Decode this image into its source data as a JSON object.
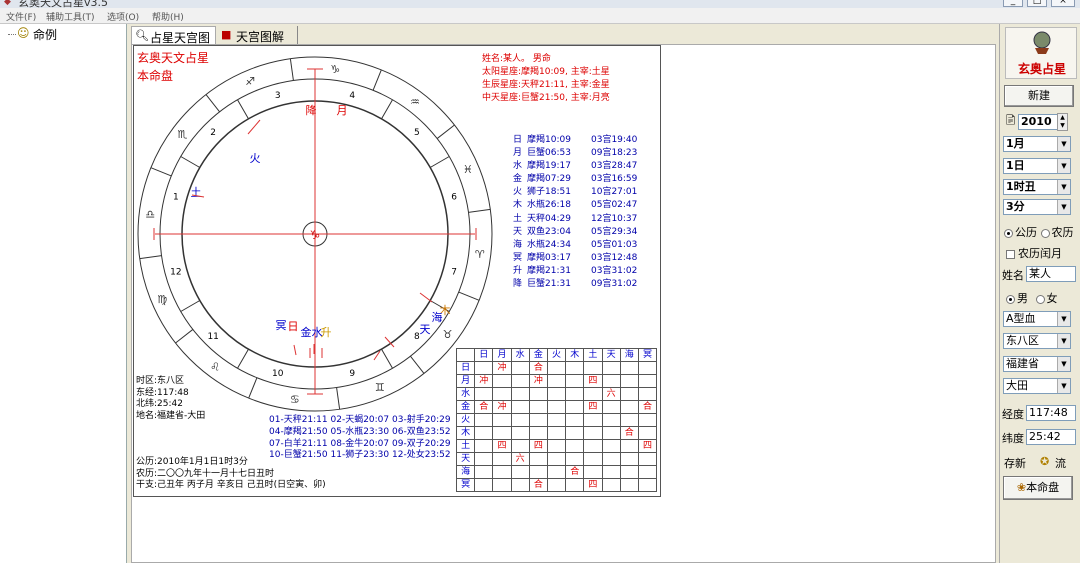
{
  "window": {
    "title": "玄奥天文占星v3.5"
  },
  "menu": [
    "文件(F)",
    "辅助工具(T)",
    "选项(O)",
    "帮助(H)"
  ],
  "tree": {
    "root": "命例"
  },
  "tabs": [
    "占星天宫图",
    "天宫图解说"
  ],
  "chart": {
    "brand": "玄奥天文占星",
    "natal_label": "本命盘",
    "person": [
      "姓名:某人。 男命",
      "太阳星座:摩羯10:09, 主宰:土星",
      "生辰星座:天秤21:11, 主宰:金星",
      "中天星座:巨蟹21:50, 主宰:月亮"
    ],
    "planets": [
      {
        "name": "日",
        "sign": "摩羯10:09",
        "house": "03宫19:40"
      },
      {
        "name": "月",
        "sign": "巨蟹06:53",
        "house": "09宫18:23"
      },
      {
        "name": "水",
        "sign": "摩羯19:17",
        "house": "03宫28:47"
      },
      {
        "name": "金",
        "sign": "摩羯07:29",
        "house": "03宫16:59"
      },
      {
        "name": "火",
        "sign": "狮子18:51",
        "house": "10宫27:01"
      },
      {
        "name": "木",
        "sign": "水瓶26:18",
        "house": "05宫02:47"
      },
      {
        "name": "土",
        "sign": "天秤04:29",
        "house": "12宫10:37"
      },
      {
        "name": "天",
        "sign": "双鱼23:04",
        "house": "05宫29:34"
      },
      {
        "name": "海",
        "sign": "水瓶24:34",
        "house": "05宫01:03"
      },
      {
        "name": "冥",
        "sign": "摩羯03:17",
        "house": "03宫12:48"
      },
      {
        "name": "升",
        "sign": "摩羯21:31",
        "house": "03宫31:02"
      },
      {
        "name": "降",
        "sign": "巨蟹21:31",
        "house": "09宫31:02"
      }
    ],
    "location": [
      "时区:东八区",
      "东经:117:48",
      "北纬:25:42",
      "地名:福建省-大田"
    ],
    "houses": [
      "01-天秤21:11  02-天蝎20:07  03-射手20:29",
      "04-摩羯21:50  05-水瓶23:30  06-双鱼23:52",
      "07-白羊21:11  08-金牛20:07  09-双子20:29",
      "10-巨蟹21:50  11-狮子23:30  12-处女23:52"
    ],
    "dates": [
      "公历:2010年1月1日1时3分",
      "农历:二〇〇九年十一月十七日丑时",
      "干支:己丑年  丙子月  辛亥日  己丑时(日空寅、卯)"
    ],
    "aspect_headers": [
      "日",
      "月",
      "水",
      "金",
      "火",
      "木",
      "土",
      "天",
      "海",
      "冥"
    ],
    "aspect_rows": [
      {
        "label": "日",
        "cells": [
          "",
          "冲",
          "",
          "合",
          "",
          "",
          "",
          "",
          "",
          ""
        ]
      },
      {
        "label": "月",
        "cells": [
          "冲",
          "",
          "",
          "冲",
          "",
          "",
          "四",
          "",
          "",
          ""
        ]
      },
      {
        "label": "水",
        "cells": [
          "",
          "",
          "",
          "",
          "",
          "",
          "",
          "六",
          "",
          ""
        ]
      },
      {
        "label": "金",
        "cells": [
          "合",
          "冲",
          "",
          "",
          "",
          "",
          "四",
          "",
          "",
          "合"
        ]
      },
      {
        "label": "火",
        "cells": [
          "",
          "",
          "",
          "",
          "",
          "",
          "",
          "",
          "",
          ""
        ]
      },
      {
        "label": "木",
        "cells": [
          "",
          "",
          "",
          "",
          "",
          "",
          "",
          "",
          "合",
          ""
        ]
      },
      {
        "label": "土",
        "cells": [
          "",
          "四",
          "",
          "四",
          "",
          "",
          "",
          "",
          "",
          "四"
        ]
      },
      {
        "label": "天",
        "cells": [
          "",
          "",
          "六",
          "",
          "",
          "",
          "",
          "",
          "",
          ""
        ]
      },
      {
        "label": "海",
        "cells": [
          "",
          "",
          "",
          "",
          "",
          "合",
          "",
          "",
          "",
          ""
        ]
      },
      {
        "label": "冥",
        "cells": [
          "",
          "",
          "",
          "合",
          "",
          "",
          "四",
          "",
          "",
          ""
        ]
      }
    ],
    "wheel": {
      "house_numbers": [
        "1",
        "2",
        "3",
        "4",
        "5",
        "6",
        "7",
        "8",
        "9",
        "10",
        "11",
        "12"
      ],
      "signs": [
        "♎",
        "♏",
        "♐",
        "♑",
        "♒",
        "♓",
        "♈",
        "♉",
        "♊",
        "♋",
        "♌",
        "♍"
      ],
      "center": "♑",
      "planet_labels": [
        "火",
        "土",
        "天",
        "木",
        "海",
        "冥",
        "日",
        "金",
        "水",
        "升",
        "降",
        "月"
      ]
    }
  },
  "panel": {
    "logo": "玄奥占星",
    "new_label": "新建",
    "year": "2010",
    "month": "1月",
    "day": "1日",
    "hour": "1时丑",
    "minute": "3分",
    "solar": "公历",
    "lunar": "农历",
    "leap": "农历闰月",
    "name_label": "姓名",
    "name_value": "某人",
    "male": "男",
    "female": "女",
    "blood": "A型血",
    "zone": "东八区",
    "province": "福建省",
    "city": "大田",
    "lon_label": "经度",
    "lon": "117:48",
    "lat_label": "纬度",
    "lat": "25:42",
    "save_label": "存新",
    "flow_label": "流",
    "natal_btn": "本命盘"
  }
}
